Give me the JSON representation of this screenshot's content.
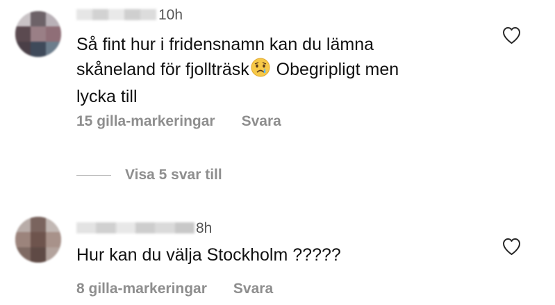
{
  "comments": [
    {
      "time": "10h",
      "text_before_emoji": "Så fint hur i fridensnamn kan du lämna\nskåneland för fjollträsk",
      "emoji": "crying-face",
      "text_after_emoji": " Obegripligt men\nlycka till",
      "likes": "15 gilla-markeringar",
      "reply": "Svara"
    },
    {
      "time": "8h",
      "text": "Hur kan du välja Stockholm ?????",
      "likes": "8 gilla-markeringar",
      "reply": "Svara"
    }
  ],
  "view_replies": "Visa 5 svar till",
  "colors": {
    "text": "#111111",
    "meta": "#8e8e8e",
    "divider": "#bdbdbd"
  },
  "icons": [
    "heart-outline-icon",
    "crying-face-emoji"
  ]
}
